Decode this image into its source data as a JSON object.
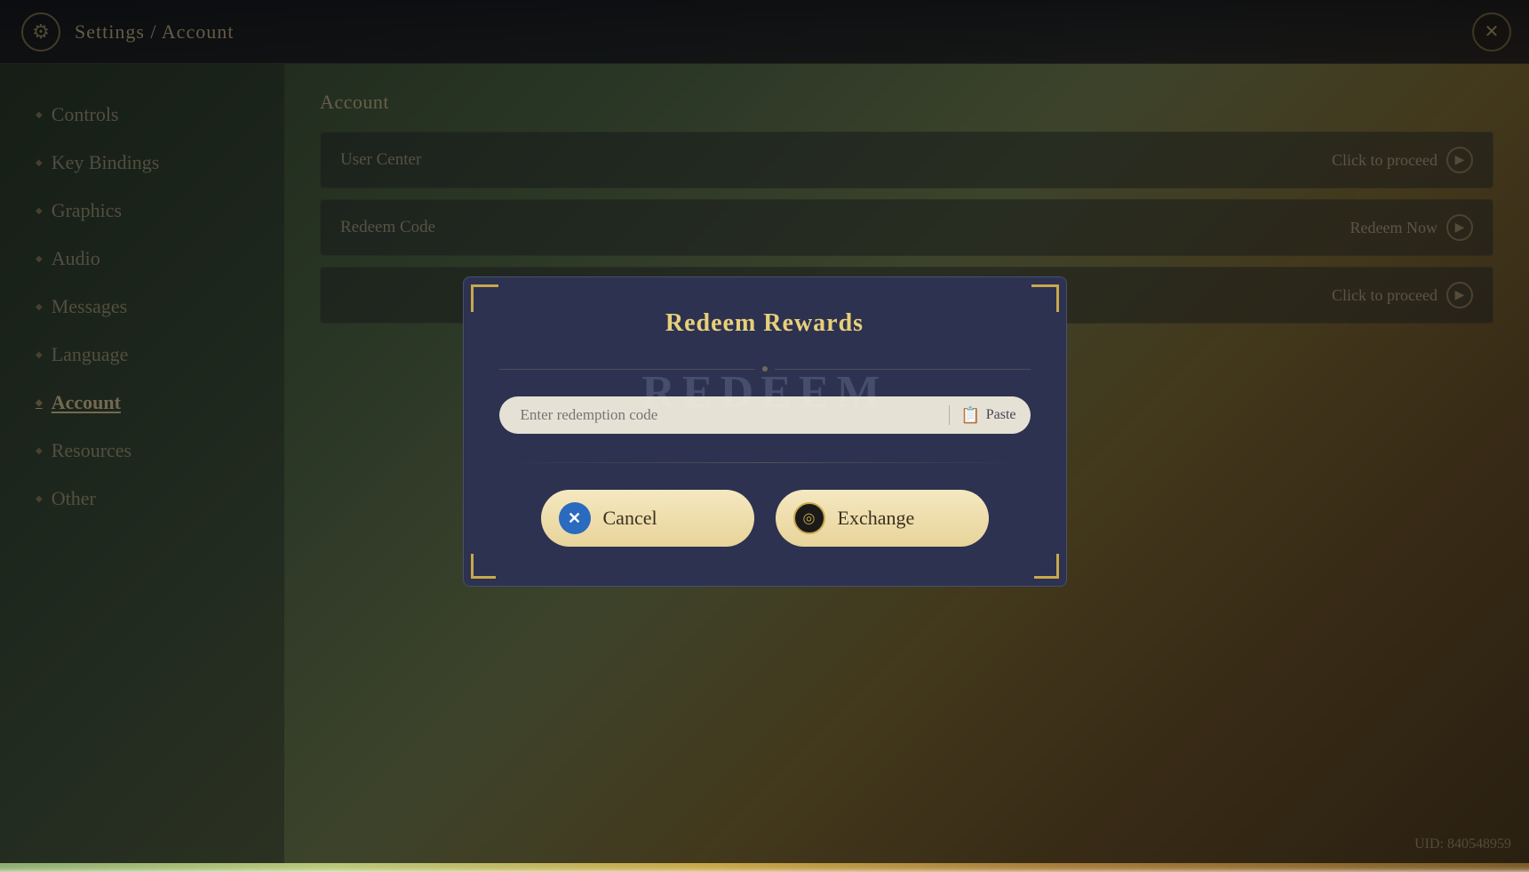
{
  "topbar": {
    "title": "Settings / Account",
    "close_label": "✕"
  },
  "sidebar": {
    "items": [
      {
        "id": "controls",
        "label": "Controls",
        "active": false
      },
      {
        "id": "key-bindings",
        "label": "Key Bindings",
        "active": false
      },
      {
        "id": "graphics",
        "label": "Graphics",
        "active": false
      },
      {
        "id": "audio",
        "label": "Audio",
        "active": false
      },
      {
        "id": "messages",
        "label": "Messages",
        "active": false
      },
      {
        "id": "language",
        "label": "Language",
        "active": false
      },
      {
        "id": "account",
        "label": "Account",
        "active": true
      },
      {
        "id": "resources",
        "label": "Resources",
        "active": false
      },
      {
        "id": "other",
        "label": "Other",
        "active": false
      }
    ]
  },
  "content": {
    "section_title": "Account",
    "rows": [
      {
        "label": "User Center",
        "action": "Click to proceed"
      },
      {
        "label": "Redeem Code",
        "action": "Redeem Now"
      },
      {
        "label": "",
        "action": "Click to proceed"
      }
    ]
  },
  "modal": {
    "title": "Redeem Rewards",
    "bg_text": "REDEEM",
    "input_placeholder": "Enter redemption code",
    "paste_label": "Paste",
    "cancel_label": "Cancel",
    "exchange_label": "Exchange",
    "cancel_icon": "✕",
    "exchange_icon": "○"
  },
  "uid": {
    "label": "UID: 840548959"
  }
}
